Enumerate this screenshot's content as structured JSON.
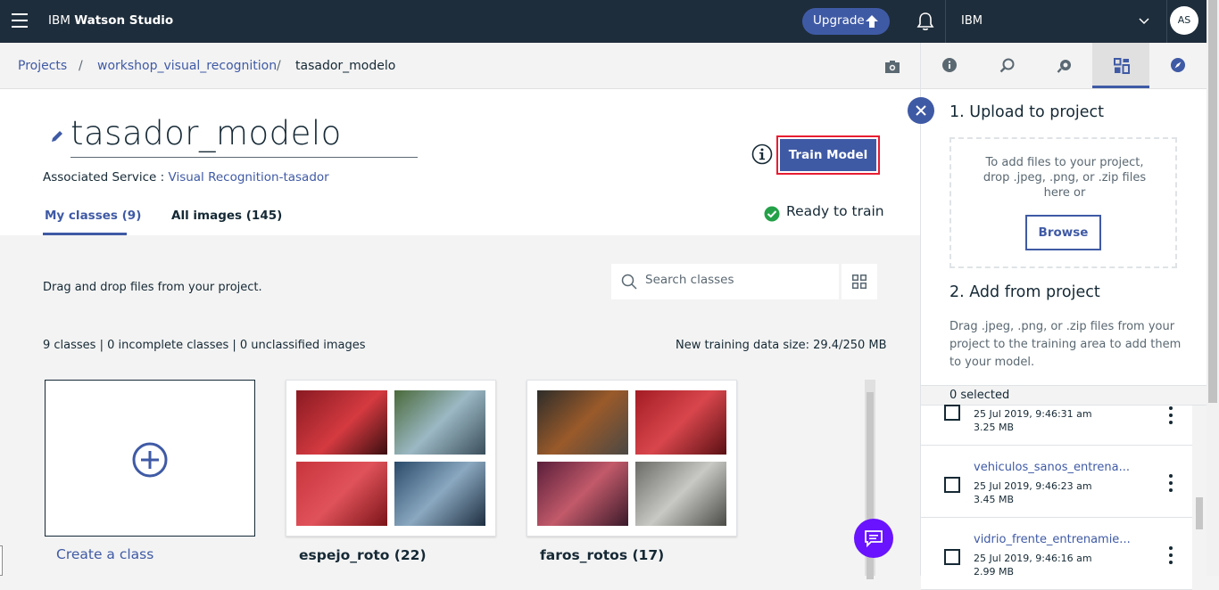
{
  "topbar": {
    "brand_prefix": "IBM ",
    "brand_name": "Watson Studio",
    "upgrade_label": "Upgrade",
    "account": "IBM",
    "avatar": "AS"
  },
  "breadcrumb": {
    "projects": "Projects",
    "sep": "/",
    "project": "workshop_visual_recognition",
    "current": "tasador_modelo"
  },
  "model": {
    "title": "tasador_modelo",
    "assoc_label": "Associated Service : ",
    "assoc_service": "Visual Recognition-tasador",
    "train_label": "Train Model",
    "status": "Ready to train",
    "status_color": "#24a148"
  },
  "tabs": {
    "my_classes": "My classes (9)",
    "all_images": "All images (145)"
  },
  "workspace": {
    "drag_text": "Drag and drop files from your project.",
    "search_placeholder": "Search classes",
    "stats": "9 classes | 0 incomplete classes | 0 unclassified images",
    "size": "New training data size: 29.4/250 MB",
    "create_label": "Create a class"
  },
  "classes": [
    {
      "name": "espejo_roto (22)",
      "thumbs": [
        "#b3202a",
        "#6a8a98",
        "#c02530",
        "#3a5a78"
      ]
    },
    {
      "name": "faros_rotos (17)",
      "thumbs": [
        "#3b3a36",
        "#b8232b",
        "#6e2a3a",
        "#8a8a86"
      ]
    }
  ],
  "panel": {
    "upload_heading": "1. Upload to project",
    "dropzone_text": "To add files to your project, drop .jpeg, .png, or .zip files here or",
    "browse_label": "Browse",
    "add_heading": "2. Add from project",
    "add_desc": "Drag .jpeg, .png, or .zip files from your project to the training area to add them to your model.",
    "selected": "0 selected",
    "files": [
      {
        "name": "",
        "date": "25 Jul 2019, 9:46:31 am",
        "size": "3.25 MB"
      },
      {
        "name": "vehiculos_sanos_entrena...",
        "date": "25 Jul 2019, 9:46:23 am",
        "size": "3.45 MB"
      },
      {
        "name": "vidrio_frente_entrenamie...",
        "date": "25 Jul 2019, 9:46:16 am",
        "size": "2.99 MB"
      }
    ]
  },
  "colors": {
    "accent": "#3f5aa5",
    "topbar": "#1e2d3b",
    "highlight": "#e71d32",
    "chat": "#6913ff"
  }
}
